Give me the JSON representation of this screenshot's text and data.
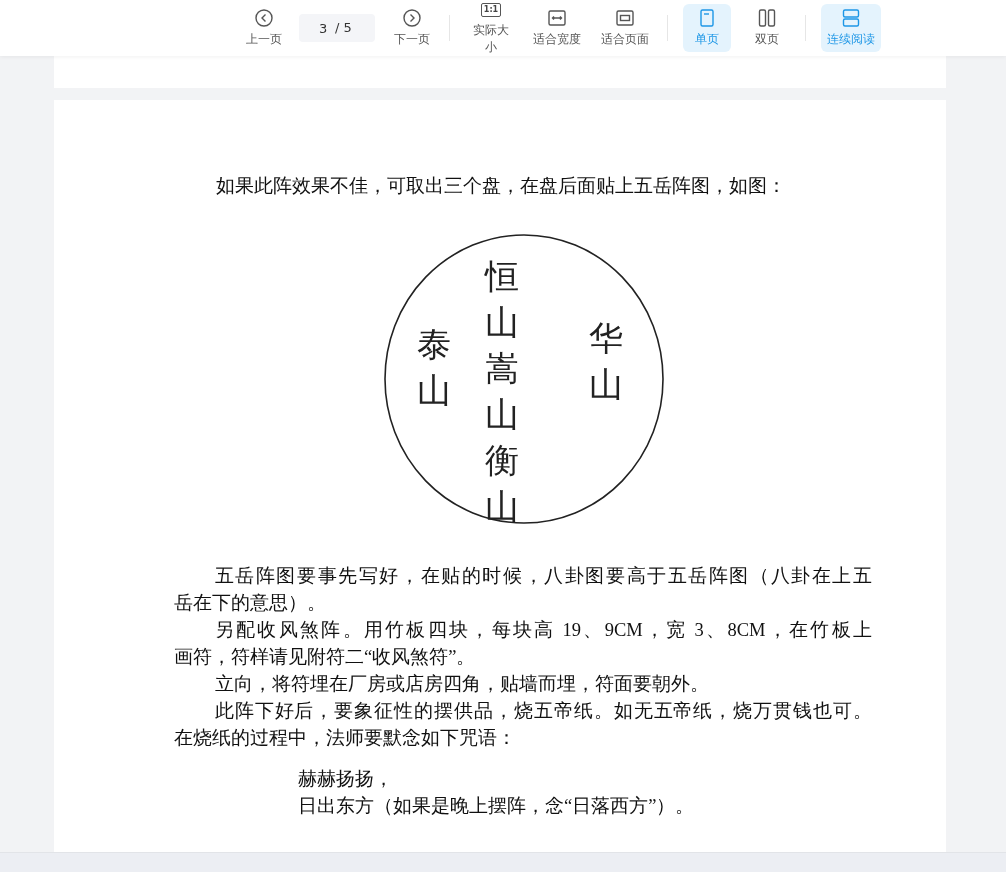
{
  "toolbar": {
    "items": [
      {
        "kind": "prev-page",
        "label": "上一页"
      },
      {
        "kind": "page-field",
        "value": "3",
        "total": "/ 5"
      },
      {
        "kind": "next-page",
        "label": "下一页"
      },
      {
        "kind": "divider"
      },
      {
        "kind": "actual-size",
        "label": "实际大小",
        "icon_text": "1:1"
      },
      {
        "kind": "fit-width",
        "label": "适合宽度"
      },
      {
        "kind": "fit-page",
        "label": "适合页面"
      },
      {
        "kind": "divider"
      },
      {
        "kind": "single-page",
        "label": "单页",
        "selected": true
      },
      {
        "kind": "double-page",
        "label": "双页",
        "selected": false
      },
      {
        "kind": "divider"
      },
      {
        "kind": "continuous",
        "label": "连续阅读",
        "on": true
      }
    ]
  },
  "page": {
    "intro": "如果此阵效果不佳，可取出三个盘，在盘后面贴上五岳阵图，如图：",
    "diagram": {
      "columns": [
        {
          "text": "泰山"
        },
        {
          "text": "恒山嵩山衡山"
        },
        {
          "text": "华山"
        }
      ]
    },
    "paragraphs": [
      {
        "lines": [
          "五岳阵图要事先写好，在贴的时候，八卦图要高于五岳阵图（八卦在上五",
          "岳在下的意思）。"
        ]
      },
      {
        "lines": [
          "另配收风煞阵。用竹板四块，每块高 19、9CM，宽 3、8CM，在竹板上",
          "画符，符样请见附符二“收风煞符”。"
        ]
      },
      {
        "lines": [
          "立向，将符埋在厂房或店房四角，贴墙而埋，符面要朝外。"
        ]
      },
      {
        "lines": [
          "此阵下好后，要象征性的摆供品，烧五帝纸。如无五帝纸，烧万贯钱也可。",
          "在烧纸的过程中，法师要默念如下咒语："
        ]
      }
    ],
    "verse": {
      "lines": [
        "赫赫扬扬，",
        "日出东方（如果是晚上摆阵，念“日落西方”）。"
      ]
    }
  }
}
